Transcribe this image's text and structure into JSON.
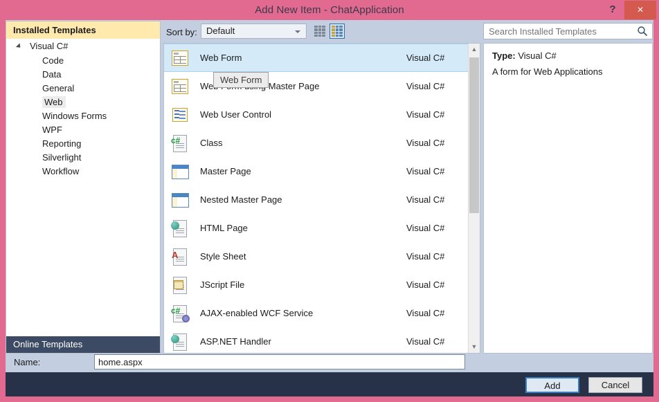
{
  "window": {
    "title": "Add New Item - ChatApplication",
    "help_label": "?",
    "close_label": "×"
  },
  "sidebar": {
    "header": "Installed Templates",
    "root": {
      "label": "Visual C#",
      "expanded": true
    },
    "items": [
      {
        "label": "Code",
        "highlighted": false
      },
      {
        "label": "Data",
        "highlighted": false
      },
      {
        "label": "General",
        "highlighted": false
      },
      {
        "label": "Web",
        "highlighted": true
      },
      {
        "label": "Windows Forms",
        "highlighted": false
      },
      {
        "label": "WPF",
        "highlighted": false
      },
      {
        "label": "Reporting",
        "highlighted": false
      },
      {
        "label": "Silverlight",
        "highlighted": false
      },
      {
        "label": "Workflow",
        "highlighted": false
      }
    ],
    "online_templates": "Online Templates"
  },
  "toolbar": {
    "sort_by_label": "Sort by:",
    "sort_value": "Default",
    "view_small_label": "small-icons-view",
    "view_medium_label": "medium-icons-view"
  },
  "search": {
    "placeholder": "Search Installed Templates",
    "value": ""
  },
  "templates": [
    {
      "name": "Web Form",
      "lang": "Visual C#",
      "icon": "web-form-icon",
      "selected": true
    },
    {
      "name": "Web Form using Master Page",
      "lang": "Visual C#",
      "icon": "web-form-master-icon",
      "selected": false
    },
    {
      "name": "Web User Control",
      "lang": "Visual C#",
      "icon": "web-user-control-icon",
      "selected": false
    },
    {
      "name": "Class",
      "lang": "Visual C#",
      "icon": "csharp-class-icon",
      "selected": false
    },
    {
      "name": "Master Page",
      "lang": "Visual C#",
      "icon": "master-page-icon",
      "selected": false
    },
    {
      "name": "Nested Master Page",
      "lang": "Visual C#",
      "icon": "nested-master-page-icon",
      "selected": false
    },
    {
      "name": "HTML Page",
      "lang": "Visual C#",
      "icon": "html-page-icon",
      "selected": false
    },
    {
      "name": "Style Sheet",
      "lang": "Visual C#",
      "icon": "style-sheet-icon",
      "selected": false
    },
    {
      "name": "JScript File",
      "lang": "Visual C#",
      "icon": "jscript-file-icon",
      "selected": false
    },
    {
      "name": "AJAX-enabled WCF Service",
      "lang": "Visual C#",
      "icon": "ajax-wcf-service-icon",
      "selected": false
    },
    {
      "name": "ASP.NET Handler",
      "lang": "Visual C#",
      "icon": "aspnet-handler-icon",
      "selected": false
    }
  ],
  "tooltip": {
    "text": "Web Form"
  },
  "info": {
    "type_label": "Type:",
    "type_value": "Visual C#",
    "description": "A form for Web Applications"
  },
  "name_field": {
    "label": "Name:",
    "value": "home.aspx",
    "placeholder": ""
  },
  "footer": {
    "add_label": "Add",
    "cancel_label": "Cancel"
  },
  "colors": {
    "window_frame": "#e2698f",
    "dialog_body": "#c3cfe0",
    "header_yellow": "#ffe9ad",
    "online_selected": "#3c4a63",
    "row_selected": "#d4eaf8",
    "footer": "#273248",
    "close_button": "#d4594f"
  }
}
